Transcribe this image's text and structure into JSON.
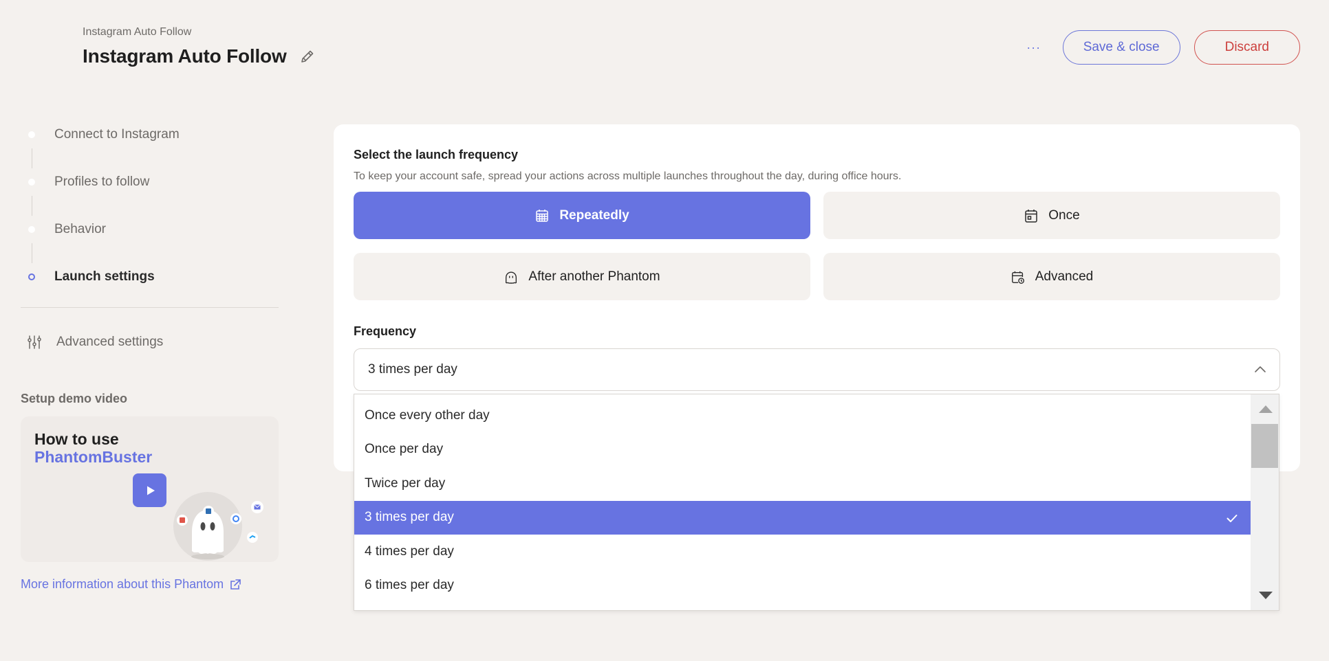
{
  "header": {
    "breadcrumb": "Instagram Auto Follow",
    "title": "Instagram Auto Follow",
    "more_label": "···",
    "save_label": "Save & close",
    "discard_label": "Discard"
  },
  "sidebar": {
    "steps": [
      {
        "label": "Connect to Instagram",
        "active": false
      },
      {
        "label": "Profiles to follow",
        "active": false
      },
      {
        "label": "Behavior",
        "active": false
      },
      {
        "label": "Launch settings",
        "active": true
      }
    ],
    "advanced_settings": "Advanced settings",
    "demo_title": "Setup demo video",
    "demo_heading_1": "How to use",
    "demo_heading_2": "PhantomBuster",
    "more_info": "More information about this Phantom"
  },
  "main": {
    "title": "Select the launch frequency",
    "subtitle": "To keep your account safe, spread your actions across multiple launches throughout the day, during office hours.",
    "options": [
      {
        "label": "Repeatedly",
        "icon": "calendar-grid-icon",
        "selected": true
      },
      {
        "label": "Once",
        "icon": "calendar-day-icon",
        "selected": false
      },
      {
        "label": "After another Phantom",
        "icon": "ghost-icon",
        "selected": false
      },
      {
        "label": "Advanced",
        "icon": "calendar-clock-icon",
        "selected": false
      }
    ],
    "frequency_label": "Frequency",
    "frequency_value": "3 times per day"
  },
  "dropdown": {
    "options": [
      {
        "label": "Once every other day",
        "selected": false
      },
      {
        "label": "Once per day",
        "selected": false
      },
      {
        "label": "Twice per day",
        "selected": false
      },
      {
        "label": "3 times per day",
        "selected": true
      },
      {
        "label": "4 times per day",
        "selected": false
      },
      {
        "label": "6 times per day",
        "selected": false
      }
    ]
  },
  "colors": {
    "accent": "#6773e1",
    "discard": "#cc3f3c",
    "background": "#f4f1ee"
  }
}
